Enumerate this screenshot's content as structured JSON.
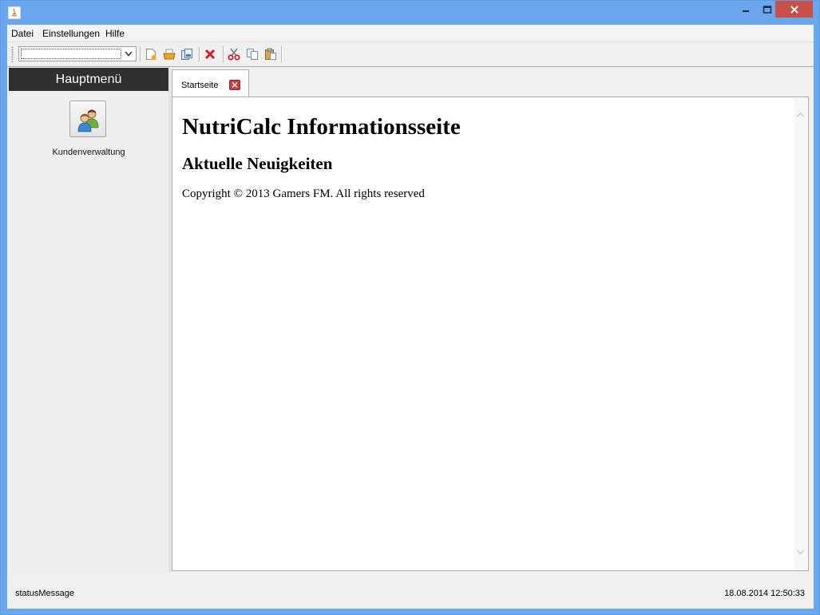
{
  "window": {
    "title": "",
    "controls": [
      "minimize-icon",
      "maximize-icon",
      "close-icon"
    ]
  },
  "menu": {
    "items": [
      "Datei",
      "Einstellungen",
      "Hilfe"
    ]
  },
  "toolbar": {
    "combo_value": "",
    "buttons": [
      "new-document-icon",
      "open-folder-icon",
      "save-icon",
      "delete-icon",
      "cut-icon",
      "copy-icon",
      "paste-icon"
    ]
  },
  "sidebar": {
    "header": "Hauptmenü",
    "items": [
      {
        "label": "Kundenverwaltung",
        "icon": "users-icon"
      }
    ]
  },
  "tabs": [
    {
      "label": "Startseite",
      "closable": true,
      "active": true
    }
  ],
  "page": {
    "heading": "NutriCalc Informationsseite",
    "subheading": "Aktuelle Neuigkeiten",
    "copyright": "Copyright © 2013 Gamers FM. All rights reserved"
  },
  "status": {
    "message": "statusMessage",
    "datetime": "18.08.2014 12:50:33"
  },
  "colors": {
    "titlebar": "#6aa7ec",
    "close_button": "#c7504a",
    "sidebar_header": "#2f2f2f",
    "tab_close": "#c9403e"
  }
}
